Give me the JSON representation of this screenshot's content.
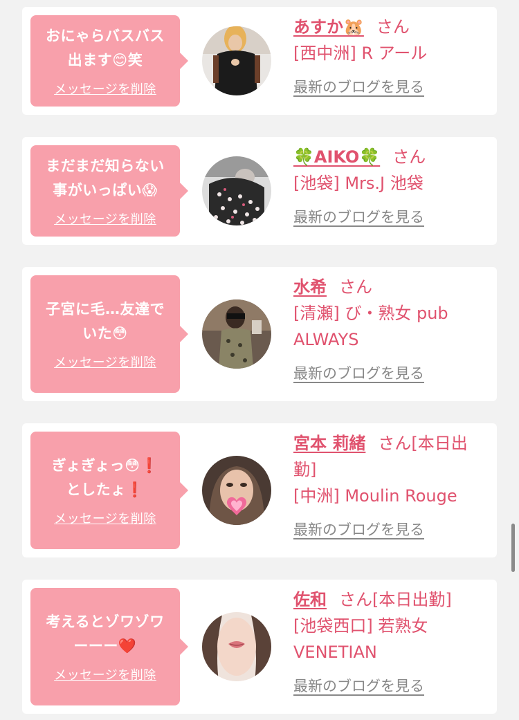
{
  "common": {
    "delete_label": "メッセージを削除",
    "blog_label": "最新のブログを見る",
    "san": "さん"
  },
  "entries": [
    {
      "message": "おにゃらバスバス\n出ます😊笑",
      "name": "あすか🐹",
      "name_suffix": "さん",
      "shop": "[西中洲] R アール",
      "avatar_icon": "woman-black-dress-photo"
    },
    {
      "message": "まだまだ知らない\n事がいっぱい😱",
      "name": "🍀AIKO🍀",
      "name_suffix": "さん",
      "shop": "[池袋] Mrs.J 池袋",
      "avatar_icon": "woman-polka-dress-photo"
    },
    {
      "message": "子宮に毛…友達で\nいた😳",
      "name": "水希",
      "name_suffix": "さん",
      "shop": "[清瀬] び・熟女 pub ALWAYS",
      "avatar_icon": "woman-mirror-selfie-photo"
    },
    {
      "message": "ぎょぎょっ😳❗\nとしたょ❗",
      "name": "宮本 莉緒",
      "name_suffix": "さん[本日出勤]",
      "shop": "[中洲] Moulin Rouge",
      "avatar_icon": "woman-face-heart-sticker-photo"
    },
    {
      "message": "考えるとゾワゾワ\nーーー❤️",
      "name": "佐和",
      "name_suffix": "さん[本日出勤]",
      "shop": "[池袋西口] 若熟女 VENETIAN",
      "avatar_icon": "woman-lips-closeup-photo"
    }
  ],
  "colors": {
    "bubble": "#f8a0ab",
    "name": "#e0526e",
    "background": "#f2f2f2"
  }
}
